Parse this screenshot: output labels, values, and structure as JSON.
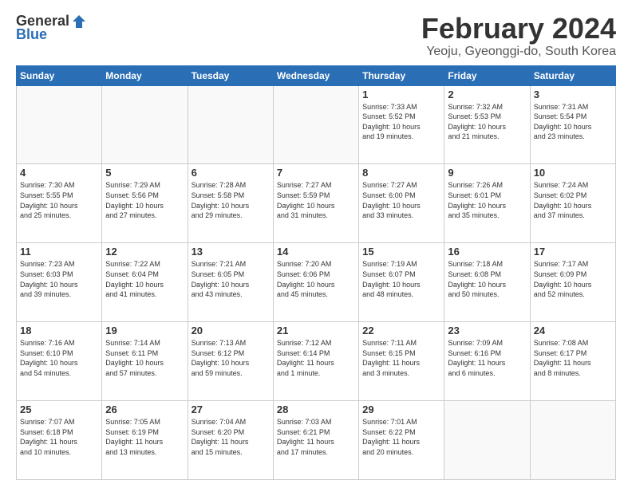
{
  "logo": {
    "general": "General",
    "blue": "Blue"
  },
  "title": {
    "month": "February 2024",
    "location": "Yeoju, Gyeonggi-do, South Korea"
  },
  "weekdays": [
    "Sunday",
    "Monday",
    "Tuesday",
    "Wednesday",
    "Thursday",
    "Friday",
    "Saturday"
  ],
  "weeks": [
    [
      {
        "day": "",
        "info": ""
      },
      {
        "day": "",
        "info": ""
      },
      {
        "day": "",
        "info": ""
      },
      {
        "day": "",
        "info": ""
      },
      {
        "day": "1",
        "info": "Sunrise: 7:33 AM\nSunset: 5:52 PM\nDaylight: 10 hours\nand 19 minutes."
      },
      {
        "day": "2",
        "info": "Sunrise: 7:32 AM\nSunset: 5:53 PM\nDaylight: 10 hours\nand 21 minutes."
      },
      {
        "day": "3",
        "info": "Sunrise: 7:31 AM\nSunset: 5:54 PM\nDaylight: 10 hours\nand 23 minutes."
      }
    ],
    [
      {
        "day": "4",
        "info": "Sunrise: 7:30 AM\nSunset: 5:55 PM\nDaylight: 10 hours\nand 25 minutes."
      },
      {
        "day": "5",
        "info": "Sunrise: 7:29 AM\nSunset: 5:56 PM\nDaylight: 10 hours\nand 27 minutes."
      },
      {
        "day": "6",
        "info": "Sunrise: 7:28 AM\nSunset: 5:58 PM\nDaylight: 10 hours\nand 29 minutes."
      },
      {
        "day": "7",
        "info": "Sunrise: 7:27 AM\nSunset: 5:59 PM\nDaylight: 10 hours\nand 31 minutes."
      },
      {
        "day": "8",
        "info": "Sunrise: 7:27 AM\nSunset: 6:00 PM\nDaylight: 10 hours\nand 33 minutes."
      },
      {
        "day": "9",
        "info": "Sunrise: 7:26 AM\nSunset: 6:01 PM\nDaylight: 10 hours\nand 35 minutes."
      },
      {
        "day": "10",
        "info": "Sunrise: 7:24 AM\nSunset: 6:02 PM\nDaylight: 10 hours\nand 37 minutes."
      }
    ],
    [
      {
        "day": "11",
        "info": "Sunrise: 7:23 AM\nSunset: 6:03 PM\nDaylight: 10 hours\nand 39 minutes."
      },
      {
        "day": "12",
        "info": "Sunrise: 7:22 AM\nSunset: 6:04 PM\nDaylight: 10 hours\nand 41 minutes."
      },
      {
        "day": "13",
        "info": "Sunrise: 7:21 AM\nSunset: 6:05 PM\nDaylight: 10 hours\nand 43 minutes."
      },
      {
        "day": "14",
        "info": "Sunrise: 7:20 AM\nSunset: 6:06 PM\nDaylight: 10 hours\nand 45 minutes."
      },
      {
        "day": "15",
        "info": "Sunrise: 7:19 AM\nSunset: 6:07 PM\nDaylight: 10 hours\nand 48 minutes."
      },
      {
        "day": "16",
        "info": "Sunrise: 7:18 AM\nSunset: 6:08 PM\nDaylight: 10 hours\nand 50 minutes."
      },
      {
        "day": "17",
        "info": "Sunrise: 7:17 AM\nSunset: 6:09 PM\nDaylight: 10 hours\nand 52 minutes."
      }
    ],
    [
      {
        "day": "18",
        "info": "Sunrise: 7:16 AM\nSunset: 6:10 PM\nDaylight: 10 hours\nand 54 minutes."
      },
      {
        "day": "19",
        "info": "Sunrise: 7:14 AM\nSunset: 6:11 PM\nDaylight: 10 hours\nand 57 minutes."
      },
      {
        "day": "20",
        "info": "Sunrise: 7:13 AM\nSunset: 6:12 PM\nDaylight: 10 hours\nand 59 minutes."
      },
      {
        "day": "21",
        "info": "Sunrise: 7:12 AM\nSunset: 6:14 PM\nDaylight: 11 hours\nand 1 minute."
      },
      {
        "day": "22",
        "info": "Sunrise: 7:11 AM\nSunset: 6:15 PM\nDaylight: 11 hours\nand 3 minutes."
      },
      {
        "day": "23",
        "info": "Sunrise: 7:09 AM\nSunset: 6:16 PM\nDaylight: 11 hours\nand 6 minutes."
      },
      {
        "day": "24",
        "info": "Sunrise: 7:08 AM\nSunset: 6:17 PM\nDaylight: 11 hours\nand 8 minutes."
      }
    ],
    [
      {
        "day": "25",
        "info": "Sunrise: 7:07 AM\nSunset: 6:18 PM\nDaylight: 11 hours\nand 10 minutes."
      },
      {
        "day": "26",
        "info": "Sunrise: 7:05 AM\nSunset: 6:19 PM\nDaylight: 11 hours\nand 13 minutes."
      },
      {
        "day": "27",
        "info": "Sunrise: 7:04 AM\nSunset: 6:20 PM\nDaylight: 11 hours\nand 15 minutes."
      },
      {
        "day": "28",
        "info": "Sunrise: 7:03 AM\nSunset: 6:21 PM\nDaylight: 11 hours\nand 17 minutes."
      },
      {
        "day": "29",
        "info": "Sunrise: 7:01 AM\nSunset: 6:22 PM\nDaylight: 11 hours\nand 20 minutes."
      },
      {
        "day": "",
        "info": ""
      },
      {
        "day": "",
        "info": ""
      }
    ]
  ]
}
